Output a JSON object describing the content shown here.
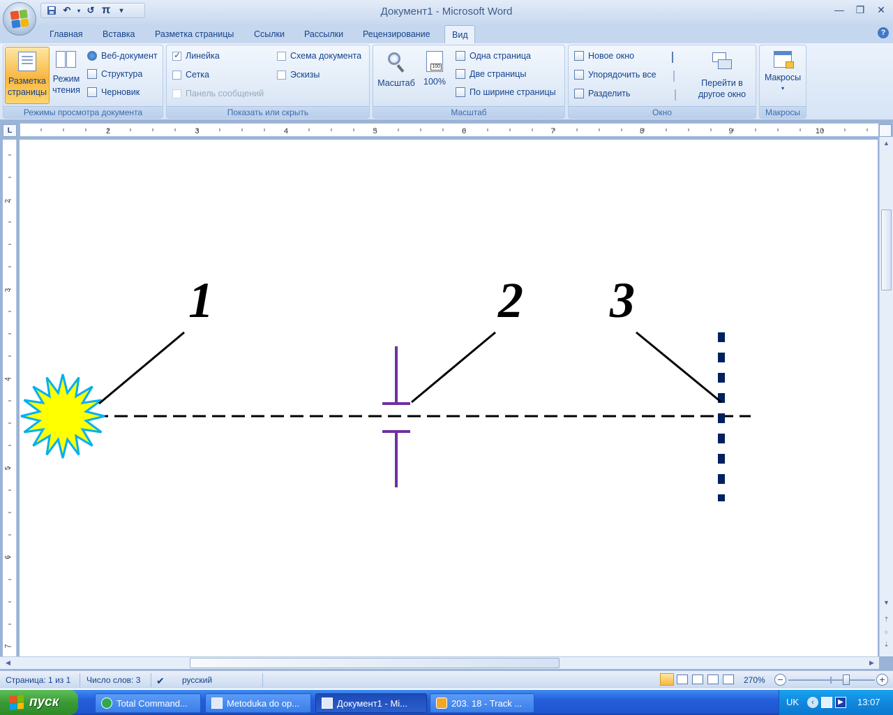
{
  "window": {
    "title": "Документ1 - Microsoft Word",
    "controls": {
      "minimize": "—",
      "restore": "❐",
      "close": "✕"
    }
  },
  "quick_access": {
    "save_icon": "save-icon",
    "undo_icon": "undo-icon",
    "redo_icon": "redo-icon",
    "pi_label": "π",
    "customize_icon": "chevron-down-icon"
  },
  "tabs": [
    {
      "label": "Главная",
      "active": false
    },
    {
      "label": "Вставка",
      "active": false
    },
    {
      "label": "Разметка страницы",
      "active": false
    },
    {
      "label": "Ссылки",
      "active": false
    },
    {
      "label": "Рассылки",
      "active": false
    },
    {
      "label": "Рецензирование",
      "active": false
    },
    {
      "label": "Вид",
      "active": true
    }
  ],
  "help_label": "?",
  "ribbon": {
    "views": {
      "group_label": "Режимы просмотра документа",
      "print_layout": "Разметка\nстраницы",
      "print_layout_1": "Разметка",
      "print_layout_2": "страницы",
      "reading_1": "Режим",
      "reading_2": "чтения",
      "web": "Веб-документ",
      "outline": "Структура",
      "draft": "Черновик"
    },
    "show_hide": {
      "group_label": "Показать или скрыть",
      "ruler": "Линейка",
      "ruler_checked": true,
      "grid": "Сетка",
      "grid_checked": false,
      "message_bar": "Панель сообщений",
      "message_bar_checked": false,
      "doc_map": "Схема документа",
      "doc_map_checked": false,
      "thumbnails": "Эскизы",
      "thumbnails_checked": false
    },
    "zoom": {
      "group_label": "Масштаб",
      "zoom": "Масштаб",
      "hundred": "100%",
      "hundred_badge": "100",
      "one_page": "Одна страница",
      "two_pages": "Две страницы",
      "page_width": "По ширине страницы"
    },
    "window": {
      "group_label": "Окно",
      "new_window": "Новое окно",
      "arrange_all": "Упорядочить все",
      "split": "Разделить",
      "switch_1": "Перейти в",
      "switch_2": "другое окно"
    },
    "macros": {
      "group_label": "Макросы",
      "macros": "Макросы"
    }
  },
  "ruler": {
    "corner": "L",
    "h_numbers": [
      "2",
      "3",
      "4",
      "5",
      "6",
      "7",
      "8",
      "9",
      "10"
    ],
    "v_numbers": [
      "2",
      "3",
      "4",
      "5",
      "6",
      "7"
    ]
  },
  "figure": {
    "label_1": "1",
    "label_2": "2",
    "label_3": "3",
    "colors": {
      "star_fill": "#ffff00",
      "star_stroke": "#00b0f0",
      "lens": "#7030a0",
      "screen": "#002060",
      "line": "#000000"
    }
  },
  "status": {
    "page": "Страница: 1 из 1",
    "words": "Число слов: 3",
    "language": "русский",
    "zoom": "270%"
  },
  "taskbar": {
    "start": "пуск",
    "tasks": [
      {
        "label": "Total Command...",
        "active": false
      },
      {
        "label": "Metoduka do op...",
        "active": false
      },
      {
        "label": "Документ1 - Mi...",
        "active": true
      },
      {
        "label": "203. 18 - Track ...",
        "active": false
      }
    ],
    "lang": "UK",
    "clock": "13:07"
  }
}
